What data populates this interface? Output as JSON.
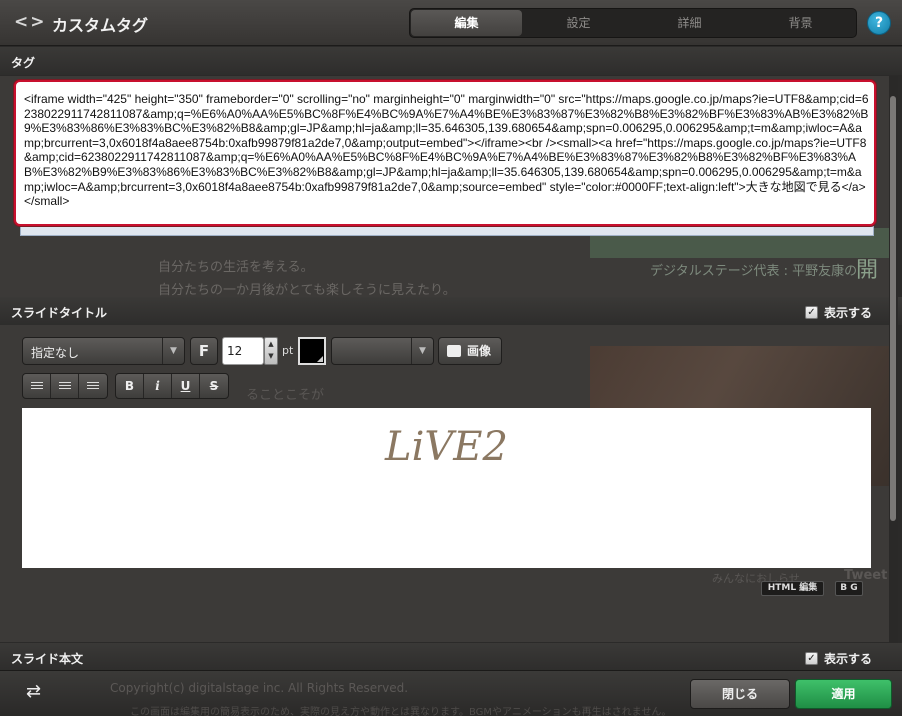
{
  "header": {
    "nav_arrows": "<>",
    "title": "カスタムタグ",
    "tabs": [
      {
        "label": "編集",
        "active": true
      },
      {
        "label": "設定",
        "active": false
      },
      {
        "label": "詳細",
        "active": false
      },
      {
        "label": "背景",
        "active": false
      }
    ],
    "help_label": "?"
  },
  "tag_section": {
    "label": "タグ",
    "code": "<iframe width=\"425\" height=\"350\" frameborder=\"0\" scrolling=\"no\" marginheight=\"0\" marginwidth=\"0\" src=\"https://maps.google.co.jp/maps?ie=UTF8&amp;cid=6238022911742811087&amp;q=%E6%A0%AA%E5%BC%8F%E4%BC%9A%E7%A4%BE%E3%83%87%E3%82%B8%E3%82%BF%E3%83%AB%E3%82%B9%E3%83%86%E3%83%BC%E3%82%B8&amp;gl=JP&amp;hl=ja&amp;ll=35.646305,139.680654&amp;spn=0.006295,0.006295&amp;t=m&amp;iwloc=A&amp;brcurrent=3,0x6018f4a8aee8754b:0xafb99879f81a2de7,0&amp;output=embed\"></iframe><br /><small><a href=\"https://maps.google.co.jp/maps?ie=UTF8&amp;cid=6238022911742811087&amp;q=%E6%A0%AA%E5%BC%8F%E4%BC%9A%E7%A4%BE%E3%83%87%E3%82%B8%E3%82%BF%E3%83%AB%E3%82%B9%E3%83%86%E3%83%BC%E3%82%B8&amp;gl=JP&amp;hl=ja&amp;ll=35.646305,139.680654&amp;spn=0.006295,0.006295&amp;t=m&amp;iwloc=A&amp;brcurrent=3,0x6018f4a8aee8754b:0xafb99879f81a2de7,0&amp;source=embed\" style=\"color:#0000FF;text-align:left\">大きな地図で見る</a></small>"
  },
  "background_page": {
    "line1": "自分たちの生活を考える。",
    "line2": "自分たちの一か月後がとても楽しそうに見えたり。",
    "line3": "デジタルステージ代表 : 平野友康の",
    "line4": "開",
    "line5": "ることこそが",
    "line6": "みんなにおしらせ",
    "line7": "Tweet"
  },
  "slide_title_section": {
    "label": "スライドタイトル",
    "show_label": "表示する",
    "show_checked": true,
    "font_select": "指定なし",
    "font_button": "F",
    "size_value": "12",
    "size_unit": "pt",
    "text_color": "#000000",
    "image_button": "画像",
    "format_buttons": [
      "B",
      "i",
      "U",
      "S"
    ],
    "preview_text": "LiVE2",
    "html_edit_label": "HTML 編集",
    "bg_label": "B G"
  },
  "slide_body_section": {
    "label": "スライド本文",
    "show_label": "表示する",
    "show_checked": true
  },
  "footer": {
    "bg_copyright": "Copyright(c) digitalstage inc. All Rights Reserved.",
    "bg_note": "この画面は編集用の簡易表示のため、実際の見え方や動作とは異なります。BGMやアニメーションも再生はされません。",
    "close_label": "閉じる",
    "apply_label": "適用"
  },
  "colors": {
    "accent_green": "#2aa653",
    "selection_red": "#c8102e",
    "help_blue": "#1a95c4",
    "title_serif": "#8b7862"
  }
}
